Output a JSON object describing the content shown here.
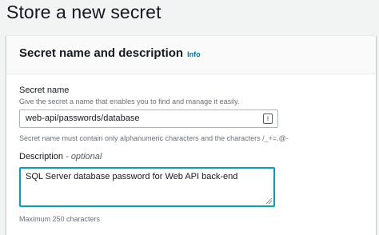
{
  "page": {
    "title": "Store a new secret"
  },
  "panel": {
    "title": "Secret name and description",
    "info_label": "Info",
    "secret_name": {
      "label": "Secret name",
      "description": "Give the secret a name that enables you to find and manage it easily.",
      "value": "web-api/passwords/database",
      "icon": "key-hint-icon",
      "constraint": "Secret name must contain only alphanumeric characters and the characters /_+=.@-"
    },
    "description": {
      "label": "Description",
      "optional_label": "- optional",
      "value": "SQL Server database password for Web API back-end",
      "footnote": "Maximum 250 characters"
    }
  },
  "colors": {
    "accent": "#00a1c9",
    "link": "#0073bb",
    "page_background": "#f2f3f3"
  }
}
